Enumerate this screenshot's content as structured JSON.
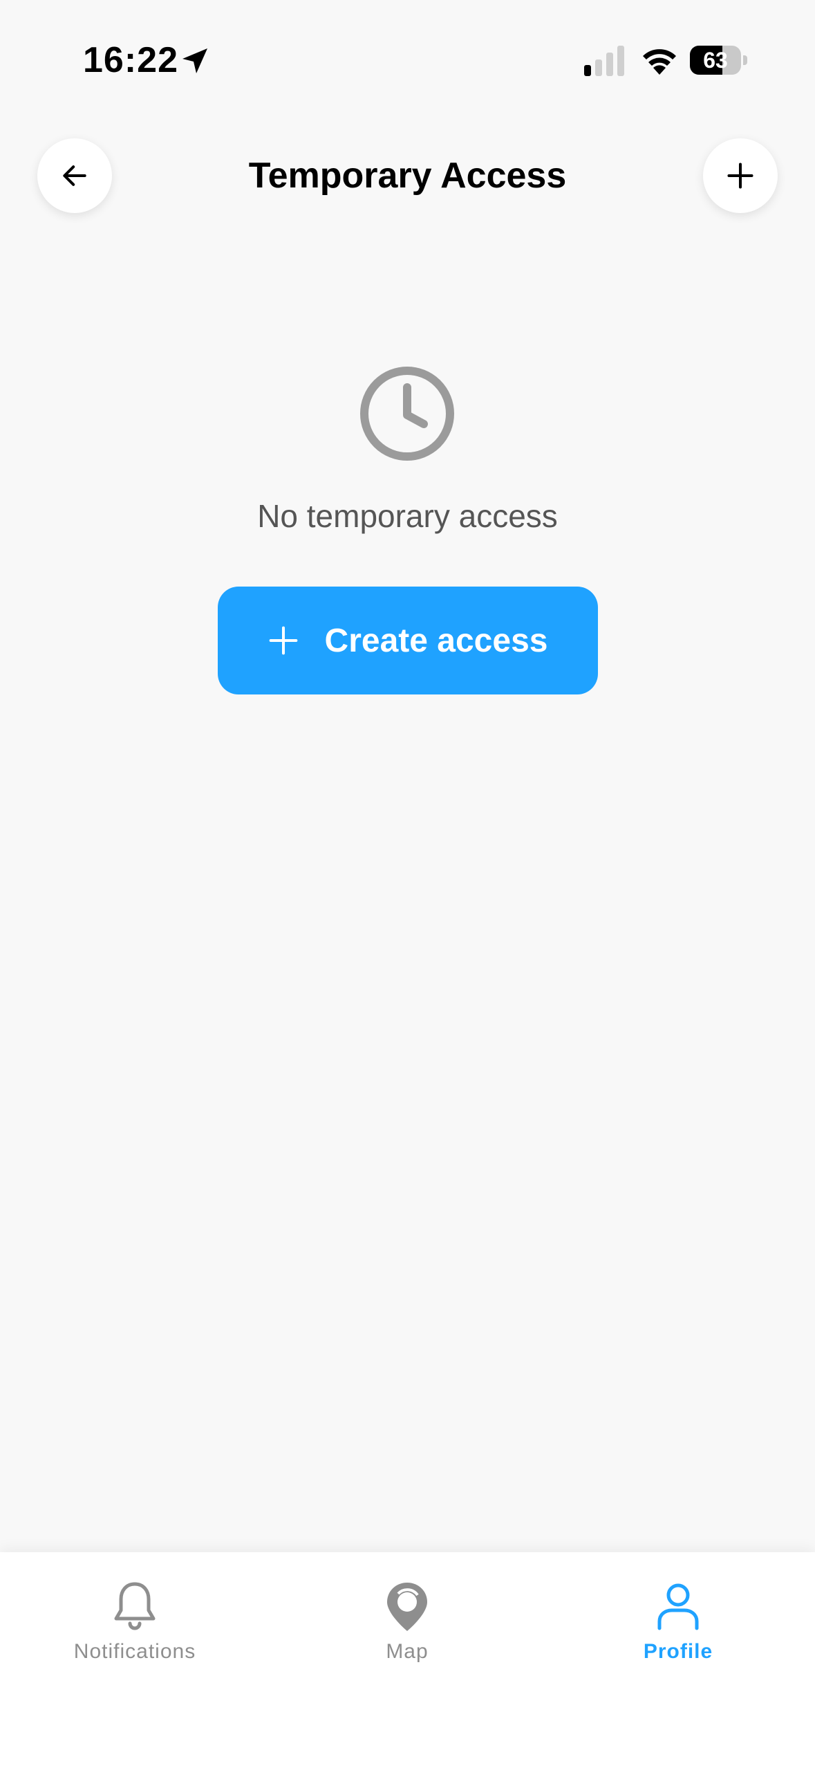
{
  "status_bar": {
    "time": "16:22",
    "battery": "63",
    "battery_level": 0.63
  },
  "header": {
    "title": "Temporary Access",
    "back_icon": "arrow-left-icon",
    "add_icon": "plus-icon"
  },
  "empty_state": {
    "icon": "clock-icon",
    "message": "No temporary access",
    "button_label": "Create access"
  },
  "tabbar": {
    "tabs": [
      {
        "label": "Notifications",
        "icon": "bell-icon",
        "active": false
      },
      {
        "label": "Map",
        "icon": "map-pin-icon",
        "active": false
      },
      {
        "label": "Profile",
        "icon": "user-icon",
        "active": true
      }
    ]
  },
  "colors": {
    "accent": "#1fa2ff",
    "background": "#f8f8f8",
    "muted": "#8e8e8e"
  }
}
